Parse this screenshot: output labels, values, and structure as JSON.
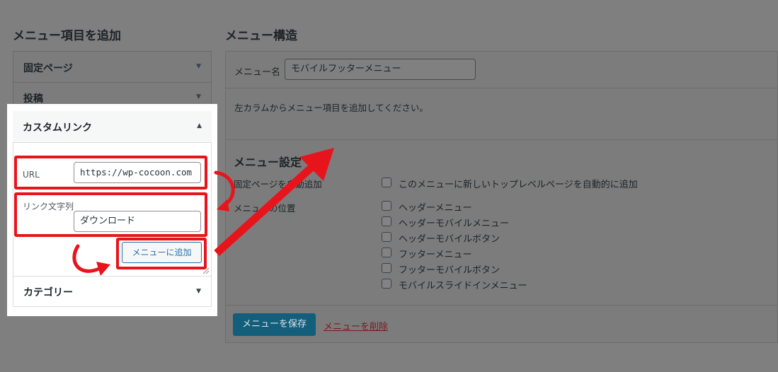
{
  "left": {
    "heading": "メニュー項目を追加",
    "sections": {
      "fixed_page": "固定ページ",
      "posts": "投稿",
      "custom_link": "カスタムリンク",
      "category": "カテゴリー"
    },
    "url_label": "URL",
    "url_value": "https://wp-cocoon.com",
    "link_text_label": "リンク文字列",
    "link_text_value": "ダウンロード",
    "add_button": "メニューに追加"
  },
  "right": {
    "heading": "メニュー構造",
    "menu_name_label": "メニュー名",
    "menu_name_value": "モバイルフッターメニュー",
    "instructions": "左カラムからメニュー項目を追加してください。",
    "settings_heading": "メニュー設定",
    "auto_add_label": "固定ページを自動追加",
    "auto_add_option": "このメニューに新しいトップレベルページを自動的に追加",
    "location_label": "メニューの位置",
    "locations": [
      "ヘッダーメニュー",
      "ヘッダーモバイルメニュー",
      "ヘッダーモバイルボタン",
      "フッターメニュー",
      "フッターモバイルボタン",
      "モバイルスライドインメニュー"
    ],
    "save_button": "メニューを保存",
    "delete_link": "メニューを削除"
  },
  "colors": {
    "highlight_red": "#e8141c",
    "primary_button": "#135e7a",
    "link_blue": "#2271b1"
  },
  "icons": {
    "section_toggle": "triangle-down-icon",
    "section_open": "triangle-up-icon",
    "annotation": "arrow-annotation"
  }
}
